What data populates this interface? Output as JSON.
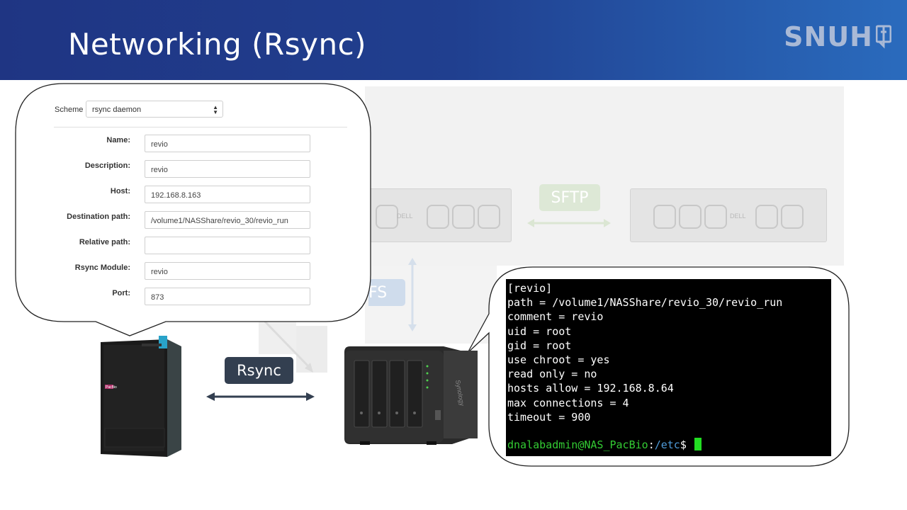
{
  "slide": {
    "title": "Networking (Rsync)",
    "logo_text": "SNUH"
  },
  "background_diagram": {
    "protocol_top": "SFTP",
    "protocol_side": "FS",
    "server_brand": "DELL"
  },
  "form": {
    "scheme_label": "Scheme",
    "scheme_value": "rsync daemon",
    "fields": [
      {
        "label": "Name:",
        "value": "revio"
      },
      {
        "label": "Description:",
        "value": "revio"
      },
      {
        "label": "Host:",
        "value": "192.168.8.163"
      },
      {
        "label": "Destination path:",
        "value": "/volume1/NASShare/revio_30/revio_run"
      },
      {
        "label": "Relative path:",
        "value": ""
      },
      {
        "label": "Rsync Module:",
        "value": "revio"
      },
      {
        "label": "Port:",
        "value": "873"
      }
    ]
  },
  "diagram": {
    "link_label": "Rsync",
    "sequencer_brand": "PacBio",
    "nas_brand": "Synology"
  },
  "terminal": {
    "lines": [
      "[revio]",
      "path = /volume1/NASShare/revio_30/revio_run",
      "comment = revio",
      "uid = root",
      "gid = root",
      "use chroot = yes",
      "read only = no",
      "hosts allow = 192.168.8.64",
      "max connections = 4",
      "timeout = 900"
    ],
    "prompt_user": "dnalabadmin@NAS_PacBio",
    "prompt_colon": ":",
    "prompt_path": "/etc",
    "prompt_symbol": "$"
  },
  "colors": {
    "header_start": "#1f3583",
    "header_end": "#2a6bbd",
    "rsync_pill": "#333f50",
    "terminal_bg": "#000000",
    "prompt_user": "#33cc33",
    "prompt_path": "#4f9bd9"
  }
}
